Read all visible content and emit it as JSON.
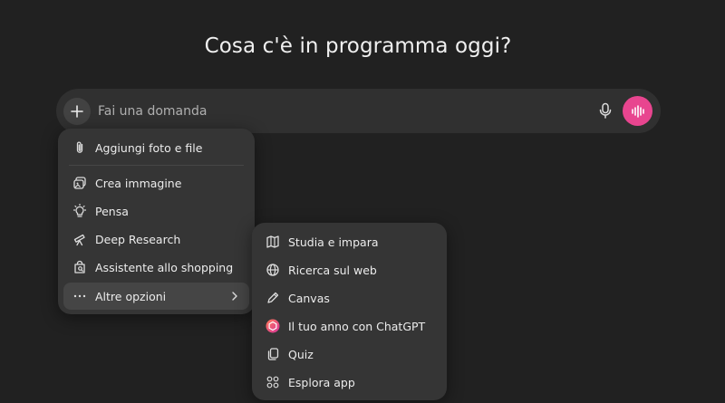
{
  "heading": "Cosa c'è in programma oggi?",
  "composer": {
    "placeholder": "Fai una domanda",
    "plus_icon": "plus-icon",
    "mic_icon": "microphone-icon",
    "voice_icon": "voice-waveform-icon",
    "voice_color": "#e8458f"
  },
  "menu": {
    "items": [
      {
        "label": "Aggiungi foto e file",
        "icon": "paperclip-icon"
      },
      {
        "label": "Crea immagine",
        "icon": "image-icon"
      },
      {
        "label": "Pensa",
        "icon": "lightbulb-icon"
      },
      {
        "label": "Deep Research",
        "icon": "telescope-icon"
      },
      {
        "label": "Assistente allo shopping",
        "icon": "shopping-bag-icon"
      },
      {
        "label": "Altre opzioni",
        "icon": "more-dots-icon",
        "active": true
      }
    ]
  },
  "submenu": {
    "items": [
      {
        "label": "Studia e impara",
        "icon": "book-icon"
      },
      {
        "label": "Ricerca sul web",
        "icon": "globe-icon"
      },
      {
        "label": "Canvas",
        "icon": "pencil-icon"
      },
      {
        "label": "Il tuo anno con ChatGPT",
        "icon": "chatgpt-logo-icon"
      },
      {
        "label": "Quiz",
        "icon": "cards-icon"
      },
      {
        "label": "Esplora app",
        "icon": "apps-grid-icon"
      }
    ]
  }
}
